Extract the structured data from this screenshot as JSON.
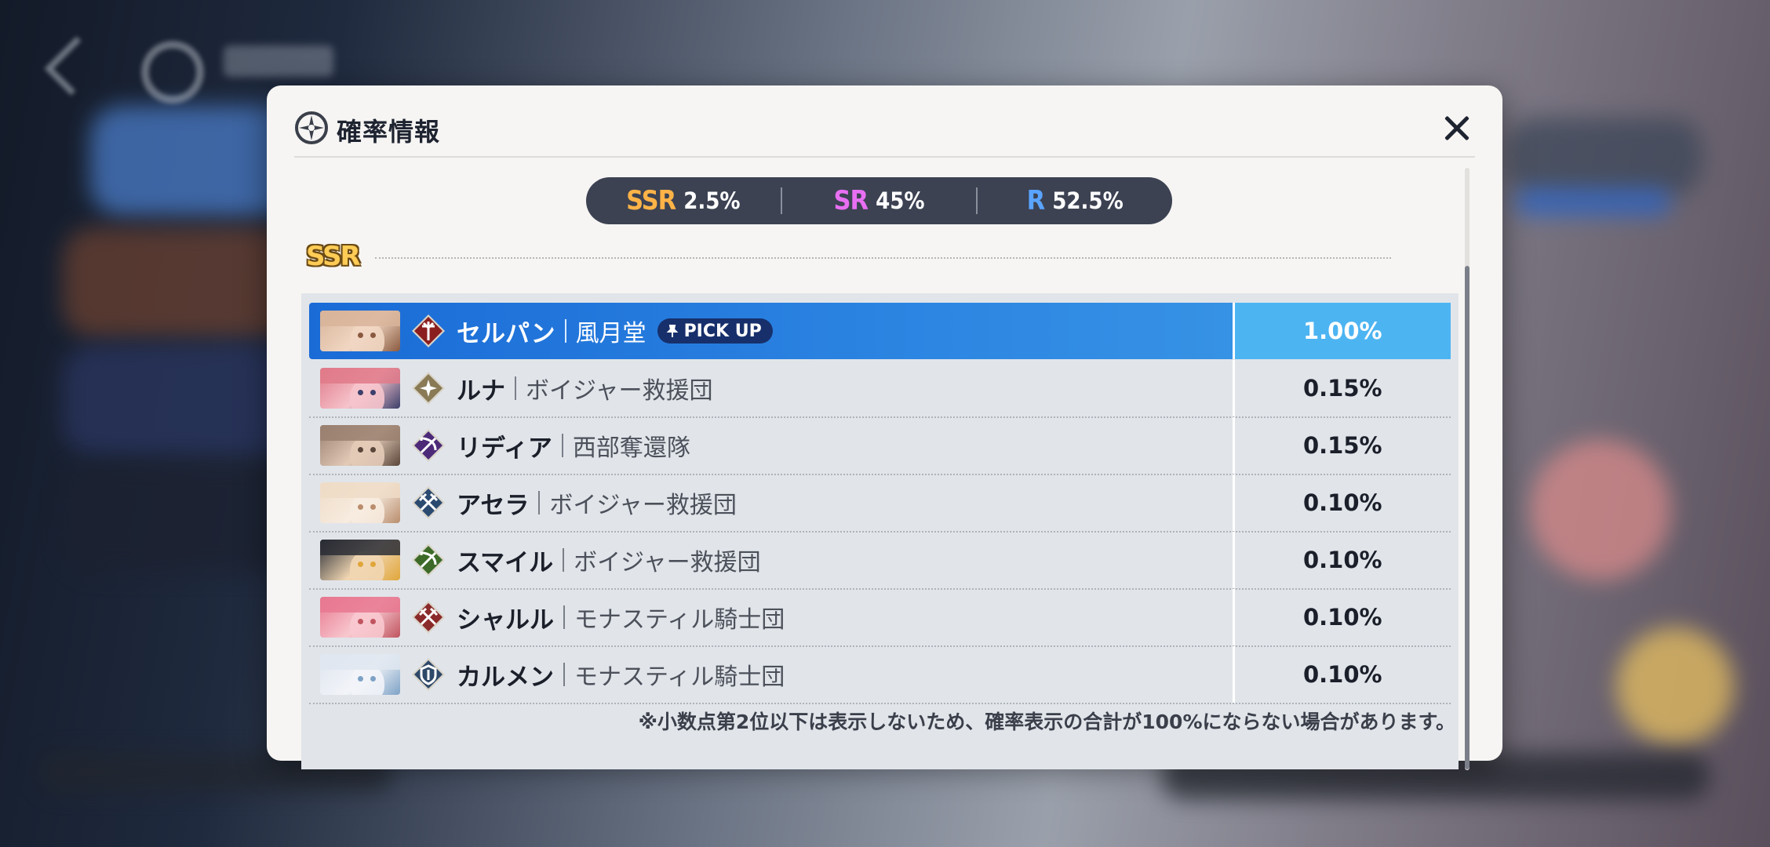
{
  "modal": {
    "title": "確率情報",
    "close_icon": "close-icon",
    "logo_icon": "compass-star-icon"
  },
  "rates": [
    {
      "tier": "SSR",
      "value": "2.5%",
      "color": "#ffb347"
    },
    {
      "tier": "SR",
      "value": "45%",
      "color": "#e86ff2"
    },
    {
      "tier": "R",
      "value": "52.5%",
      "color": "#5aa4ff"
    }
  ],
  "section": {
    "label": "SSR"
  },
  "characters": [
    {
      "name": "セルパン",
      "faction": "風月堂",
      "rate": "1.00%",
      "pickup": "PICK UP",
      "selected": true,
      "icon_color": "#8b1f1f",
      "class_icon": "staff-class-icon",
      "avatar_tones": [
        "#d8b49a",
        "#f1d7c3",
        "#8a5a40"
      ]
    },
    {
      "name": "ルナ",
      "faction": "ボイジャー救援団",
      "rate": "0.15%",
      "selected": false,
      "icon_color": "#8a7a55",
      "class_icon": "star-class-icon",
      "avatar_tones": [
        "#e07a8a",
        "#f6c4cc",
        "#3b3f6b"
      ]
    },
    {
      "name": "リディア",
      "faction": "西部奪還隊",
      "rate": "0.15%",
      "selected": false,
      "icon_color": "#4c2a78",
      "class_icon": "bow-class-icon",
      "avatar_tones": [
        "#9a8070",
        "#e3cbb8",
        "#5a463a"
      ]
    },
    {
      "name": "アセラ",
      "faction": "ボイジャー救援団",
      "rate": "0.10%",
      "selected": false,
      "icon_color": "#2b4a70",
      "class_icon": "crossed-swords-class-icon",
      "avatar_tones": [
        "#efdcc7",
        "#f7ece0",
        "#b98d6d"
      ]
    },
    {
      "name": "スマイル",
      "faction": "ボイジャー救援団",
      "rate": "0.10%",
      "selected": false,
      "icon_color": "#3d6a28",
      "class_icon": "bow-class-icon",
      "avatar_tones": [
        "#2a2d35",
        "#f1d6b2",
        "#e0a63a"
      ]
    },
    {
      "name": "シャルル",
      "faction": "モナスティル騎士団",
      "rate": "0.10%",
      "selected": false,
      "icon_color": "#8b2a2a",
      "class_icon": "crossed-swords-class-icon",
      "avatar_tones": [
        "#e87890",
        "#f8c8cf",
        "#c0545f"
      ]
    },
    {
      "name": "カルメン",
      "faction": "モナスティル騎士団",
      "rate": "0.10%",
      "selected": false,
      "icon_color": "#2e4868",
      "class_icon": "shield-class-icon",
      "avatar_tones": [
        "#dfe6f0",
        "#f2f4f8",
        "#7ea2c6"
      ]
    }
  ],
  "footnote": "※小数点第2位以下は表示しないため、確率表示の合計が100%にならない場合があります。"
}
